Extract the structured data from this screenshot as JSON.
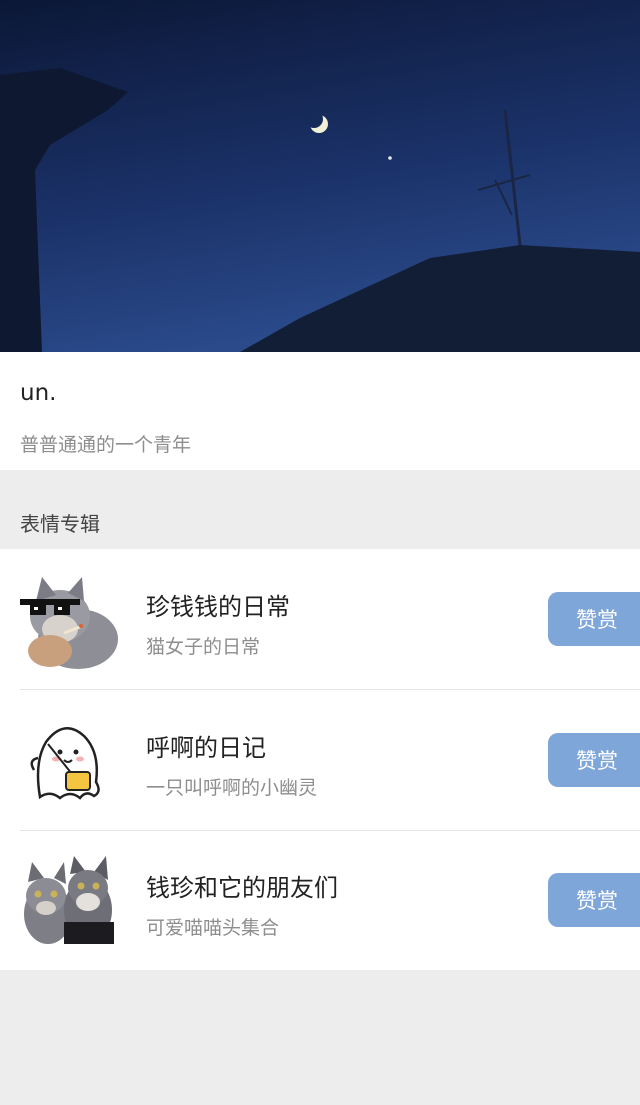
{
  "profile": {
    "name": "un.",
    "bio": "普普通通的一个青年"
  },
  "section": {
    "title": "表情专辑"
  },
  "albums": [
    {
      "title": "珍钱钱的日常",
      "subtitle": "猫女子的日常",
      "button": "赞赏",
      "icon": "sunglasses-cat-sticker"
    },
    {
      "title": "呼啊的日记",
      "subtitle": "一只叫呼啊的小幽灵",
      "button": "赞赏",
      "icon": "ghost-sticker"
    },
    {
      "title": "钱珍和它的朋友们",
      "subtitle": "可爱喵喵头集合",
      "button": "赞赏",
      "icon": "two-cats-sticker"
    }
  ],
  "colors": {
    "page_bg": "#ededed",
    "card_bg": "#ffffff",
    "button_bg": "#7ea6d8",
    "sky_dark": "#0d1a3a",
    "sky_light": "#233f7a"
  }
}
